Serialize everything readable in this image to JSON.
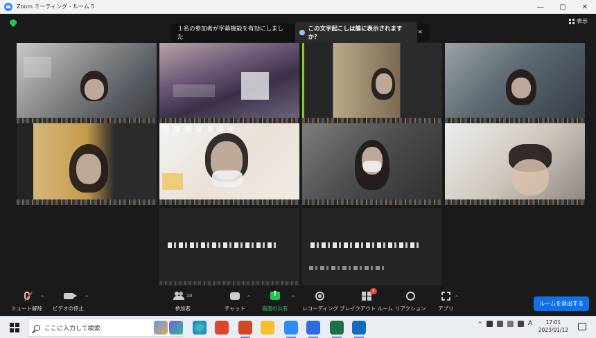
{
  "window": {
    "title": "Zoom ミーティング - ルーム 5",
    "controls": [
      "—",
      "▢",
      "✕"
    ]
  },
  "meeting": {
    "view_label": "表示",
    "caption_notice": "１名の参加者が字幕機能を有効にしました",
    "caption_link": "この文字起こしは誰に表示されますか？",
    "close_glyph": "✕",
    "tiles": 10
  },
  "toolbar": {
    "mute": "ミュート解除",
    "video": "ビデオの停止",
    "participants": "参加者",
    "participants_count": "10",
    "chat": "チャット",
    "share": "画面の共有",
    "record": "レコーディング",
    "breakout": "ブレイクアウト ルーム",
    "breakout_badge": "3",
    "reactions": "リアクション",
    "apps": "アプリ",
    "leave": "ルームを退出する",
    "caret": "^"
  },
  "taskbar": {
    "search_placeholder": "ここに入力して検索",
    "ime": "A",
    "time": "17:01",
    "date": "2023/01/12"
  }
}
